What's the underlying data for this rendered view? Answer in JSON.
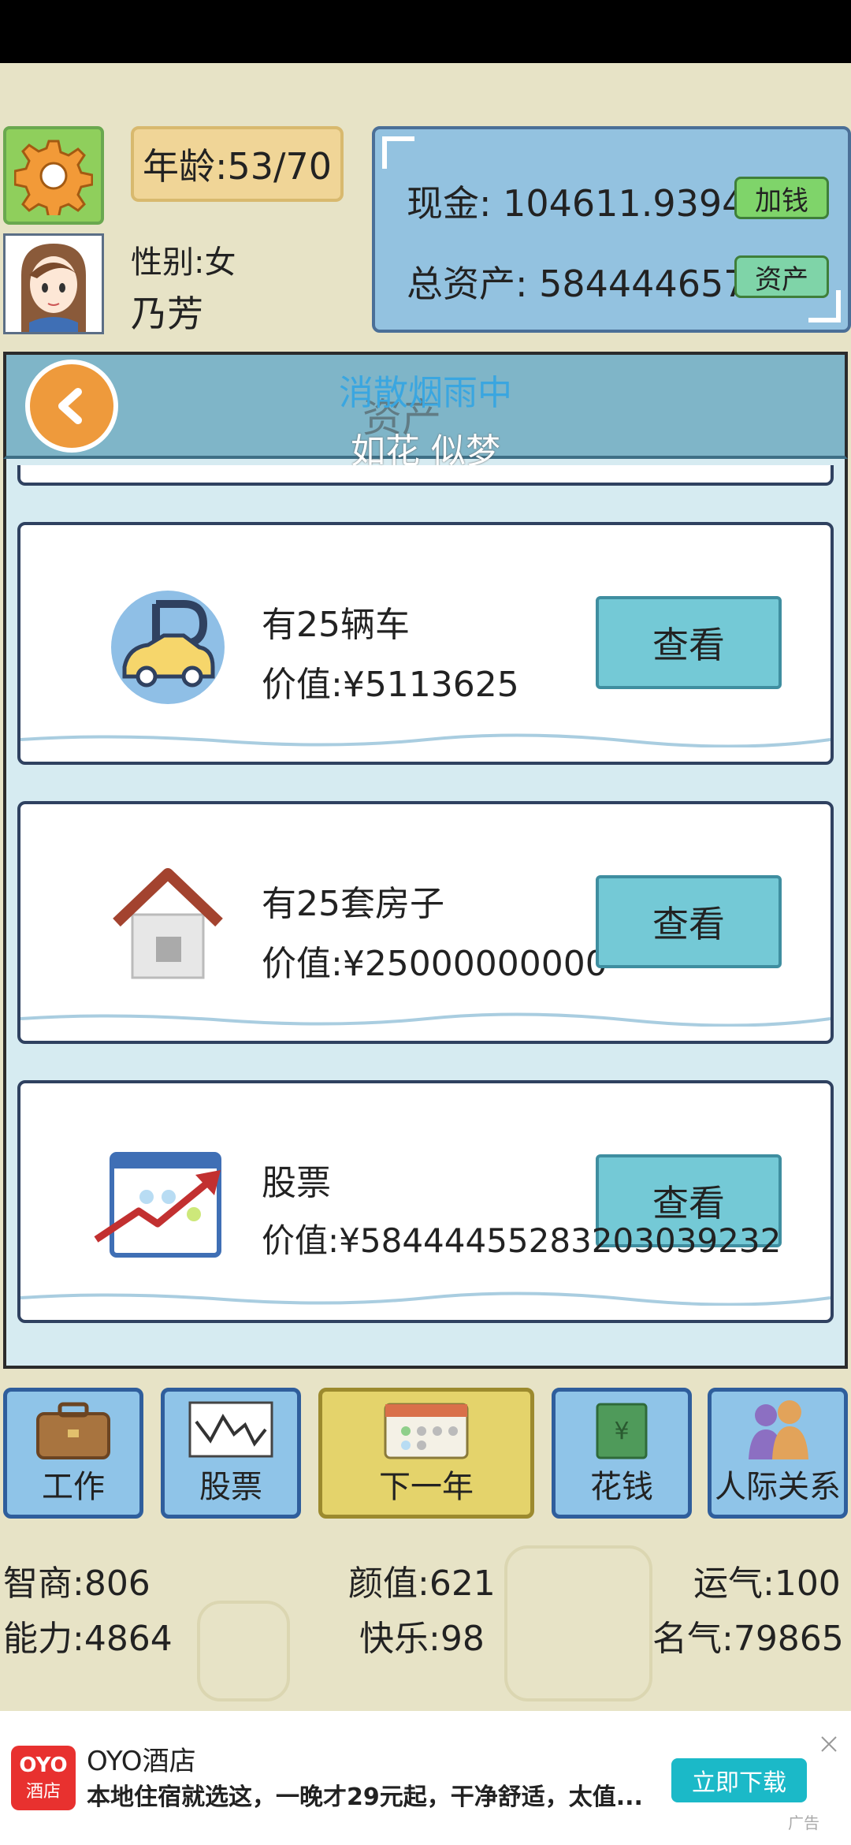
{
  "header": {
    "age_label": "年龄:53/70",
    "gender_label": "性别:女",
    "name": "乃芳"
  },
  "money": {
    "cash_label": "现金: 104611.9394亿",
    "add_money_button": "加钱",
    "total_assets_label": "总资产: 58444465760",
    "assets_button": "资产"
  },
  "modal": {
    "title": "资产",
    "overlay_line1": "消散烟雨中",
    "overlay_line2": "如花 似梦"
  },
  "assets": [
    {
      "title": "有25辆车",
      "value": "价值:¥5113625",
      "button": "查看",
      "icon": "car-icon"
    },
    {
      "title": "有25套房子",
      "value": "价值:¥25000000000",
      "button": "查看",
      "icon": "house-icon"
    },
    {
      "title": "股票",
      "value": "价值:¥5844445528320303923​2",
      "button": "查看",
      "icon": "stock-chart-icon"
    }
  ],
  "nav": [
    {
      "label": "工作",
      "icon": "briefcase-icon"
    },
    {
      "label": "股票",
      "icon": "stock-chart-icon"
    },
    {
      "label": "下一年",
      "icon": "calendar-icon"
    },
    {
      "label": "花钱",
      "icon": "money-icon"
    },
    {
      "label": "人际关系",
      "icon": "people-icon"
    }
  ],
  "stats": {
    "iq": "智商:806",
    "looks": "颜值:621",
    "luck": "运气:100",
    "ability": "能力:4864",
    "happiness": "快乐:98",
    "fame": "名气:79865"
  },
  "ad": {
    "logo_top": "OYO",
    "logo_bottom": "酒店",
    "title": "OYO酒店",
    "text": "本地住宿就选这，一晚才29元起，干净舒适，太值...",
    "button": "立即下载",
    "tag": "广告"
  }
}
